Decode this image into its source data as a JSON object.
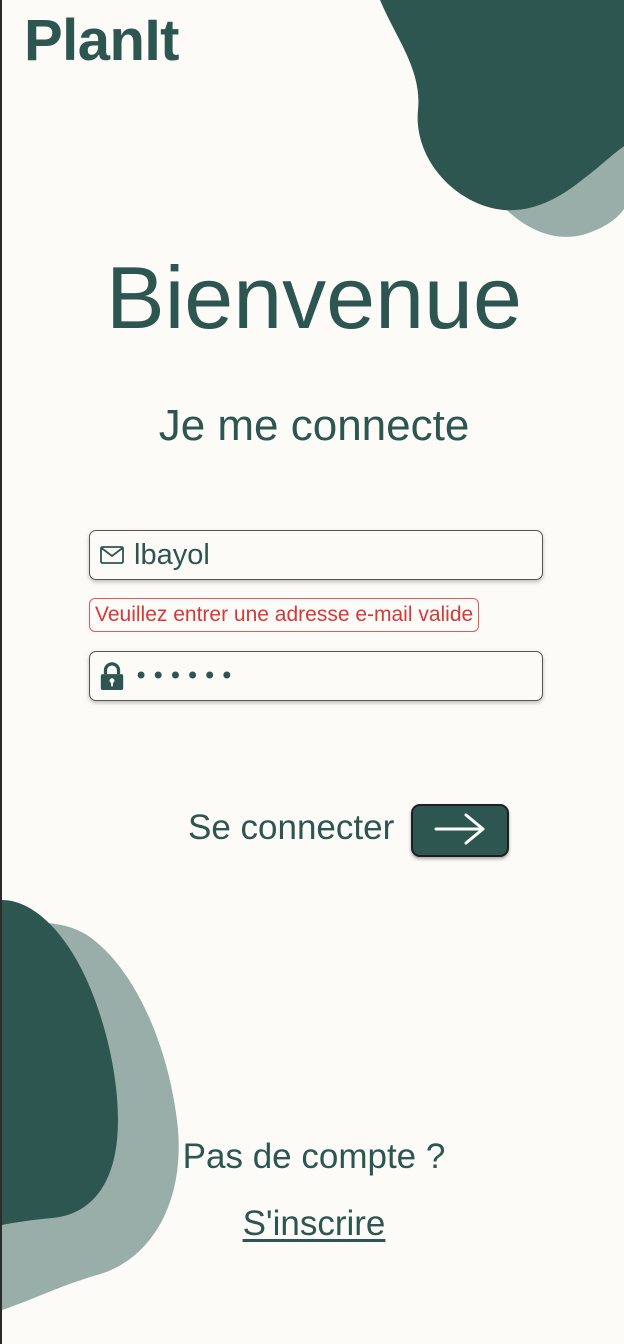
{
  "app": {
    "brand": "PlanIt"
  },
  "colors": {
    "primary": "#2d5650",
    "primary_light": "#9aaea9",
    "background": "#fdfbf8",
    "error": "#d33a3a"
  },
  "header": {
    "welcome": "Bienvenue",
    "subtitle": "Je me connecte"
  },
  "login_form": {
    "email": {
      "icon": "mail-icon",
      "value": "lbayol",
      "error": "Veuillez entrer une adresse e-mail valide"
    },
    "password": {
      "icon": "lock-icon",
      "masked_value": "••••••"
    },
    "submit": {
      "label": "Se connecter",
      "icon": "arrow-right-icon"
    }
  },
  "footer": {
    "no_account": "Pas de compte ?",
    "signup_link": "S'inscrire"
  }
}
